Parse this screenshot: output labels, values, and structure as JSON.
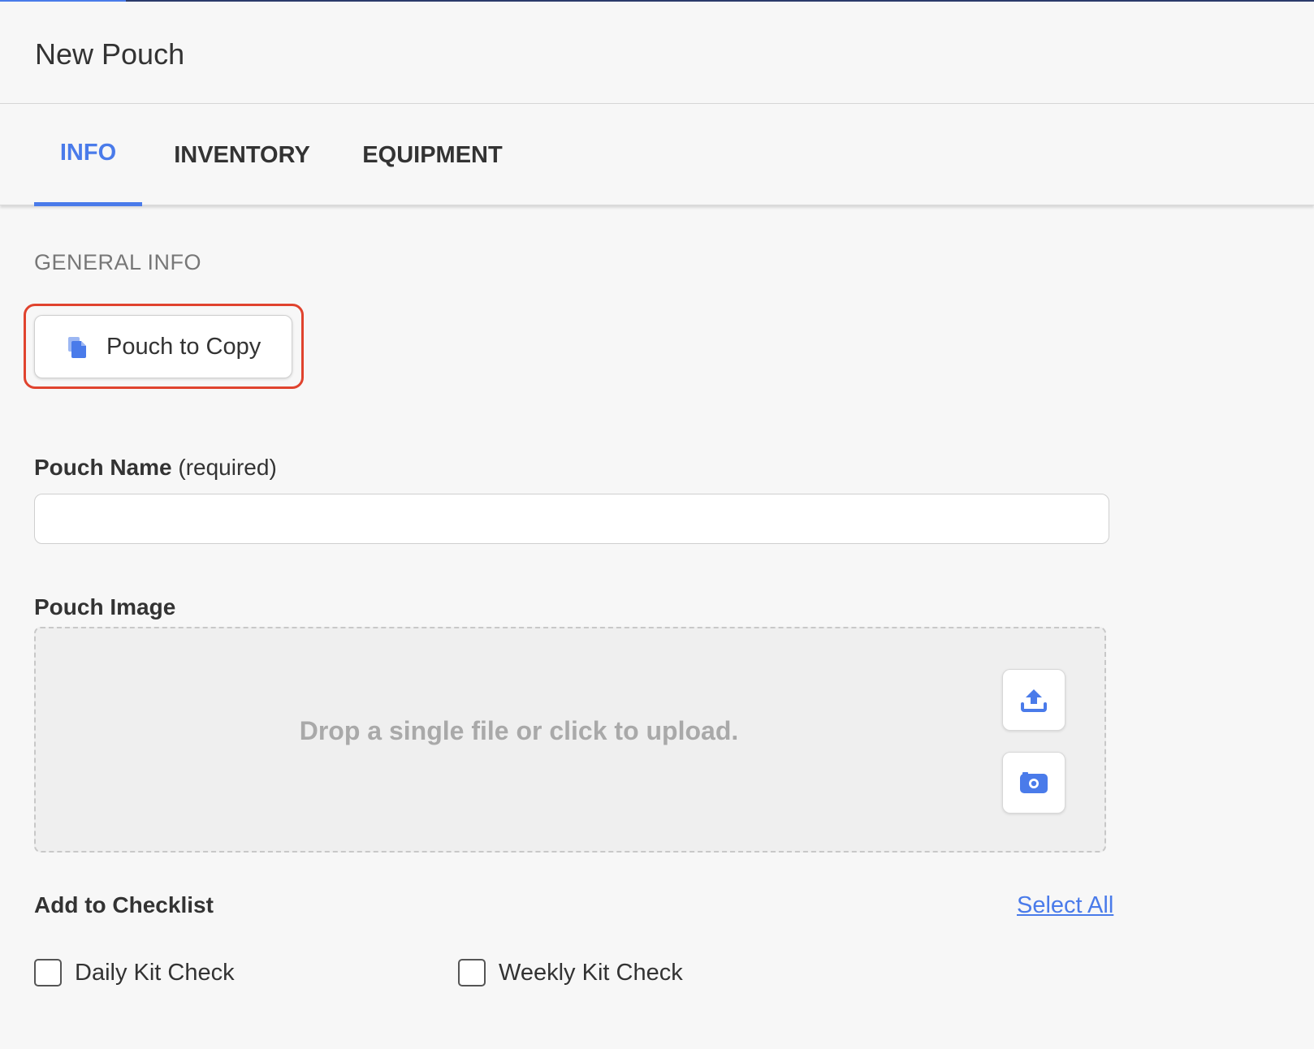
{
  "header": {
    "title": "New Pouch"
  },
  "tabs": [
    {
      "label": "INFO",
      "active": true
    },
    {
      "label": "INVENTORY",
      "active": false
    },
    {
      "label": "EQUIPMENT",
      "active": false
    }
  ],
  "general_info": {
    "section_label": "GENERAL INFO",
    "copy_button_label": "Pouch to Copy",
    "copy_icon": "copy-document-icon"
  },
  "pouch_name": {
    "label": "Pouch Name",
    "required_text": "(required)",
    "value": "",
    "placeholder": ""
  },
  "pouch_image": {
    "label": "Pouch Image",
    "dropzone_text": "Drop a single file or click to upload.",
    "upload_icon": "upload-icon",
    "camera_icon": "camera-icon"
  },
  "checklist": {
    "label": "Add to Checklist",
    "select_all_label": "Select All",
    "items": [
      {
        "label": "Daily Kit Check",
        "checked": false
      },
      {
        "label": "Weekly Kit Check",
        "checked": false
      }
    ]
  },
  "colors": {
    "accent": "#4a7bea",
    "highlight": "#e0432e",
    "background": "#f7f7f7"
  }
}
